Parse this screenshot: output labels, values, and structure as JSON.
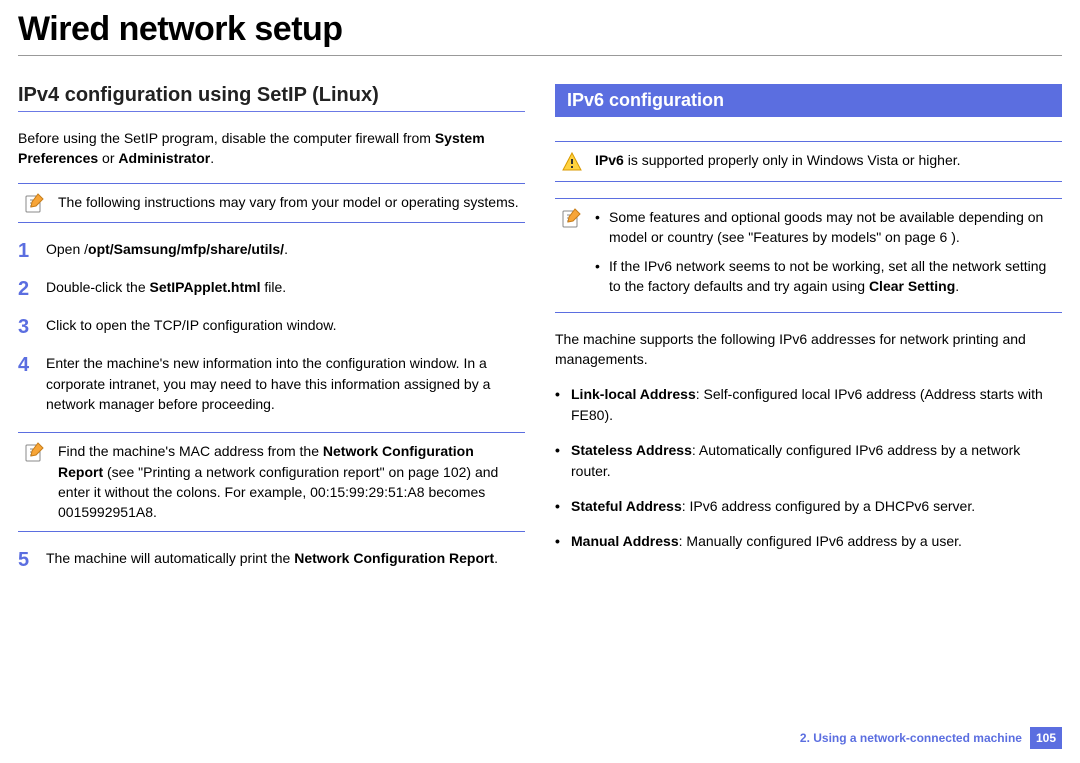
{
  "title": "Wired network setup",
  "left": {
    "heading": "IPv4 configuration using SetIP (Linux)",
    "intro_pre": "Before using the SetIP program, disable the computer firewall from ",
    "intro_b1": "System Preferences",
    "intro_or": " or ",
    "intro_b2": "Administrator",
    "intro_end": ".",
    "note1": "The following instructions may vary from your model or operating systems.",
    "step1_pre": "Open /",
    "step1_b": "opt/Samsung/mfp/share/utils/",
    "step1_end": ".",
    "step2_pre": "Double-click the ",
    "step2_b": "SetIPApplet.html",
    "step2_end": " file.",
    "step3": "Click to open the TCP/IP configuration window.",
    "step4": "Enter the machine's new information into the configuration window. In a corporate intranet, you may need to have this information assigned by a network manager before proceeding.",
    "note2_pre": "Find the machine's MAC address from the ",
    "note2_b": "Network Configuration Report",
    "note2_post": " (see \"Printing a network configuration report\" on page 102) and enter it without the colons. For example, 00:15:99:29:51:A8 becomes 0015992951A8.",
    "step5_pre": "The machine will automatically print the ",
    "step5_b": "Network Configuration Report",
    "step5_end": "."
  },
  "right": {
    "banner": "IPv6 configuration",
    "warn_b": "IPv6",
    "warn_text": " is supported properly only in Windows Vista or higher.",
    "note_li1": "Some features and optional goods may not be available depending on model or country (see \"Features by models\" on page 6 ).",
    "note_li2_pre": "If the IPv6 network seems to not be working, set all the network setting to the factory defaults and try again using ",
    "note_li2_b": "Clear Setting",
    "note_li2_end": ".",
    "para": "The machine supports the following IPv6 addresses for network printing and managements.",
    "b1_b": "Link-local Address",
    "b1_t": ": Self-configured local IPv6 address (Address starts with FE80).",
    "b2_b": "Stateless Address",
    "b2_t": ": Automatically configured IPv6 address by a network router.",
    "b3_b": "Stateful Address",
    "b3_t": ": IPv6 address configured by a DHCPv6 server.",
    "b4_b": "Manual Address",
    "b4_t": ": Manually configured IPv6 address by a user."
  },
  "footer": {
    "chapter": "2.  Using a network-connected machine",
    "page": "105"
  }
}
